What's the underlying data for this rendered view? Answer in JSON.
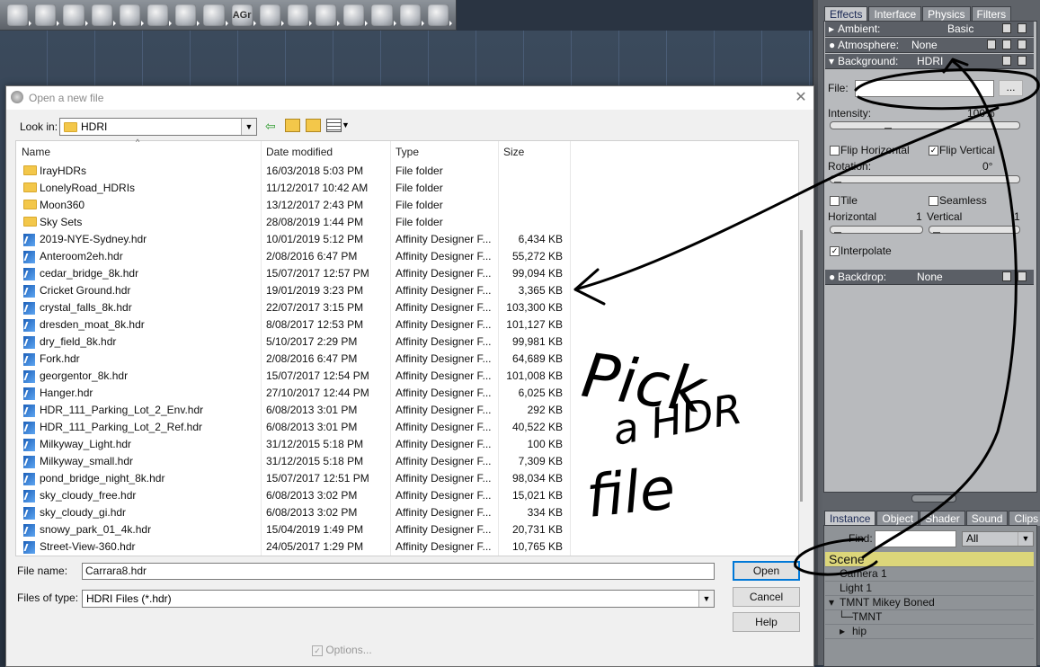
{
  "toolbar": {
    "icons": [
      "joint-icon",
      "particles-icon",
      "terrain-icon",
      "plant-icon",
      "ocean-icon",
      "fire-icon",
      "cloud-icon",
      "grass-icon",
      "text-icon",
      "bowl-icon",
      "spring-icon",
      "tool-icon",
      "camera-icon",
      "lights-icon",
      "target-icon",
      "wrench-icon"
    ],
    "text_icon_label": "AGr"
  },
  "dialog": {
    "title": "Open a new file",
    "look_in_label": "Look in:",
    "look_in_value": "HDRI",
    "columns": [
      "Name",
      "Date modified",
      "Type",
      "Size"
    ],
    "files": [
      {
        "name": "IrayHDRs",
        "date": "16/03/2018 5:03 PM",
        "type": "File folder",
        "size": "",
        "kind": "folder"
      },
      {
        "name": "LonelyRoad_HDRIs",
        "date": "11/12/2017 10:42 AM",
        "type": "File folder",
        "size": "",
        "kind": "folder"
      },
      {
        "name": "Moon360",
        "date": "13/12/2017 2:43 PM",
        "type": "File folder",
        "size": "",
        "kind": "folder"
      },
      {
        "name": "Sky Sets",
        "date": "28/08/2019 1:44 PM",
        "type": "File folder",
        "size": "",
        "kind": "folder"
      },
      {
        "name": "2019-NYE-Sydney.hdr",
        "date": "10/01/2019 5:12 PM",
        "type": "Affinity Designer F...",
        "size": "6,434 KB",
        "kind": "file"
      },
      {
        "name": "Anteroom2eh.hdr",
        "date": "2/08/2016 6:47 PM",
        "type": "Affinity Designer F...",
        "size": "55,272 KB",
        "kind": "file"
      },
      {
        "name": "cedar_bridge_8k.hdr",
        "date": "15/07/2017 12:57 PM",
        "type": "Affinity Designer F...",
        "size": "99,094 KB",
        "kind": "file"
      },
      {
        "name": "Cricket Ground.hdr",
        "date": "19/01/2019 3:23 PM",
        "type": "Affinity Designer F...",
        "size": "3,365 KB",
        "kind": "file"
      },
      {
        "name": "crystal_falls_8k.hdr",
        "date": "22/07/2017 3:15 PM",
        "type": "Affinity Designer F...",
        "size": "103,300 KB",
        "kind": "file"
      },
      {
        "name": "dresden_moat_8k.hdr",
        "date": "8/08/2017 12:53 PM",
        "type": "Affinity Designer F...",
        "size": "101,127 KB",
        "kind": "file"
      },
      {
        "name": "dry_field_8k.hdr",
        "date": "5/10/2017 2:29 PM",
        "type": "Affinity Designer F...",
        "size": "99,981 KB",
        "kind": "file"
      },
      {
        "name": "Fork.hdr",
        "date": "2/08/2016 6:47 PM",
        "type": "Affinity Designer F...",
        "size": "64,689 KB",
        "kind": "file"
      },
      {
        "name": "georgentor_8k.hdr",
        "date": "15/07/2017 12:54 PM",
        "type": "Affinity Designer F...",
        "size": "101,008 KB",
        "kind": "file"
      },
      {
        "name": "Hanger.hdr",
        "date": "27/10/2017 12:44 PM",
        "type": "Affinity Designer F...",
        "size": "6,025 KB",
        "kind": "file"
      },
      {
        "name": "HDR_111_Parking_Lot_2_Env.hdr",
        "date": "6/08/2013 3:01 PM",
        "type": "Affinity Designer F...",
        "size": "292 KB",
        "kind": "file"
      },
      {
        "name": "HDR_111_Parking_Lot_2_Ref.hdr",
        "date": "6/08/2013 3:01 PM",
        "type": "Affinity Designer F...",
        "size": "40,522 KB",
        "kind": "file"
      },
      {
        "name": "Milkyway_Light.hdr",
        "date": "31/12/2015 5:18 PM",
        "type": "Affinity Designer F...",
        "size": "100 KB",
        "kind": "file"
      },
      {
        "name": "Milkyway_small.hdr",
        "date": "31/12/2015 5:18 PM",
        "type": "Affinity Designer F...",
        "size": "7,309 KB",
        "kind": "file"
      },
      {
        "name": "pond_bridge_night_8k.hdr",
        "date": "15/07/2017 12:51 PM",
        "type": "Affinity Designer F...",
        "size": "98,034 KB",
        "kind": "file"
      },
      {
        "name": "sky_cloudy_free.hdr",
        "date": "6/08/2013 3:02 PM",
        "type": "Affinity Designer F...",
        "size": "15,021 KB",
        "kind": "file"
      },
      {
        "name": "sky_cloudy_gi.hdr",
        "date": "6/08/2013 3:02 PM",
        "type": "Affinity Designer F...",
        "size": "334 KB",
        "kind": "file"
      },
      {
        "name": "snowy_park_01_4k.hdr",
        "date": "15/04/2019 1:49 PM",
        "type": "Affinity Designer F...",
        "size": "20,731 KB",
        "kind": "file"
      },
      {
        "name": "Street-View-360.hdr",
        "date": "24/05/2017 1:29 PM",
        "type": "Affinity Designer F...",
        "size": "10,765 KB",
        "kind": "file"
      }
    ],
    "file_name_label": "File name:",
    "file_name_value": "Carrara8.hdr",
    "file_type_label": "Files of type:",
    "file_type_value": "HDRI Files (*.hdr)",
    "open_label": "Open",
    "cancel_label": "Cancel",
    "help_label": "Help",
    "options_label": "Options..."
  },
  "panel": {
    "tabs": [
      "Effects",
      "Interface",
      "Physics",
      "Filters"
    ],
    "ambient_label": "Ambient:",
    "ambient_value": "Basic",
    "atmosphere_label": "Atmosphere:",
    "atmosphere_value": "None",
    "background_label": "Background:",
    "background_value": "HDRI",
    "file_label": "File:",
    "file_button": "...",
    "intensity_label": "Intensity:",
    "intensity_value": "100%",
    "flip_h_label": "Flip Horizontal",
    "flip_v_label": "Flip Vertical",
    "rotation_label": "Rotation:",
    "rotation_value": "0°",
    "tile_label": "Tile",
    "seamless_label": "Seamless",
    "horizontal_label": "Horizontal",
    "horizontal_value": "1",
    "vertical_label": "Vertical",
    "vertical_value": "1",
    "interpolate_label": "Interpolate",
    "backdrop_label": "Backdrop:",
    "backdrop_value": "None",
    "check": "✓"
  },
  "scene_panel": {
    "tabs": [
      "Instance",
      "Object",
      "Shader",
      "Sound",
      "Clips"
    ],
    "find_label": "Find:",
    "find_value": "",
    "filter_value": "All",
    "tree": [
      "Scene",
      "Camera 1",
      "Light 1",
      "TMNT Mikey Boned",
      "TMNT",
      "hip"
    ]
  },
  "annotation": {
    "line1": "Pick",
    "line2": "a HDR",
    "line3": "file"
  }
}
